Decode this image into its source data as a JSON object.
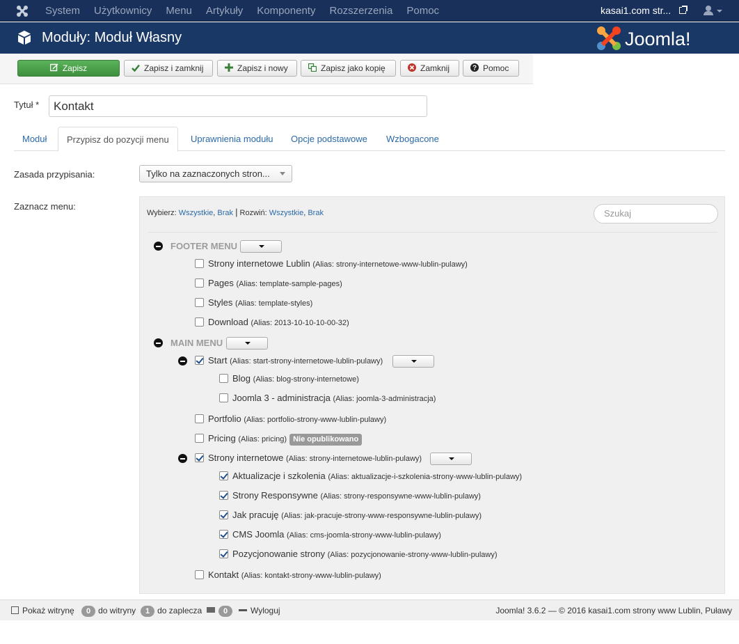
{
  "navbar": {
    "menu": [
      "System",
      "Użytkownicy",
      "Menu",
      "Artykuły",
      "Komponenty",
      "Rozszerzenia",
      "Pomoc"
    ],
    "site_name": "kasai1.com str...",
    "icons": [
      "joomla-icon",
      "external-link-icon",
      "user-icon"
    ]
  },
  "titlebar": {
    "title": "Moduły: Moduł Własny",
    "brand": "Joomla!"
  },
  "toolbar": {
    "save": "Zapisz",
    "save_close": "Zapisz i zamknij",
    "save_new": "Zapisz i nowy",
    "save_copy": "Zapisz jako kopię",
    "close": "Zamknij",
    "help": "Pomoc"
  },
  "form": {
    "title_label": "Tytuł *",
    "title_value": "Kontakt"
  },
  "tabs": [
    "Moduł",
    "Przypisz do pozycji menu",
    "Uprawnienia modułu",
    "Opcje podstawowe",
    "Wzbogacone"
  ],
  "assignment": {
    "label": "Zasada przypisania:",
    "value": "Tylko na zaznaczonych stron..."
  },
  "menu_select": {
    "label": "Zaznacz menu:",
    "select_label": "Wybierz:",
    "expand_label": "Rozwiń:",
    "all": "Wszystkie",
    "none": "Brak",
    "separator": ",",
    "pipe": "|",
    "search_placeholder": "Szukaj"
  },
  "tree": {
    "footer_menu": {
      "name": "FOOTER MENU",
      "items": [
        {
          "title": "Strony internetowe Lublin",
          "alias": "(Alias: strony-internetowe-www-lublin-pulawy)",
          "checked": false
        },
        {
          "title": "Pages",
          "alias": "(Alias: template-sample-pages)",
          "checked": false
        },
        {
          "title": "Styles",
          "alias": "(Alias: template-styles)",
          "checked": false
        },
        {
          "title": "Download",
          "alias": "(Alias: 2013-10-10-10-00-32)",
          "checked": false
        }
      ]
    },
    "main_menu": {
      "name": "MAIN MENU",
      "start": {
        "title": "Start",
        "alias": "(Alias: start-strony-internetowe-lublin-pulawy)",
        "checked": true
      },
      "start_children": [
        {
          "title": "Blog",
          "alias": "(Alias: blog-strony-internetowe)",
          "checked": false
        },
        {
          "title": "Joomla 3 - administracja",
          "alias": "(Alias: joomla-3-administracja)",
          "checked": false
        }
      ],
      "portfolio": {
        "title": "Portfolio",
        "alias": "(Alias: portfolio-strony-www-lublin-pulawy)",
        "checked": false
      },
      "pricing": {
        "title": "Pricing",
        "alias": "(Alias: pricing)",
        "checked": false,
        "badge": "Nie opublikowano"
      },
      "strony": {
        "title": "Strony internetowe",
        "alias": "(Alias: strony-internetowe-lublin-pulawy)",
        "checked": true
      },
      "strony_children": [
        {
          "title": "Aktualizacje i szkolenia",
          "alias": "(Alias: aktualizacje-i-szkolenia-strony-www-lublin-pulawy)",
          "checked": true
        },
        {
          "title": "Strony Responsywne",
          "alias": "(Alias: strony-responsywne-www-lublin-pulawy)",
          "checked": true
        },
        {
          "title": "Jak pracuję",
          "alias": "(Alias: jak-pracuje-strony-www-responsywne-lublin-pulawy)",
          "checked": true
        },
        {
          "title": "CMS Joomla",
          "alias": "(Alias: cms-joomla-strony-www-lublin-pulawy)",
          "checked": true
        },
        {
          "title": "Pozycjonowanie strony",
          "alias": "(Alias: pozycjonowanie-strony-www-lublin-pulawy)",
          "checked": true
        }
      ],
      "kontakt": {
        "title": "Kontakt",
        "alias": "(Alias: kontakt-strony-www-lublin-pulawy)",
        "checked": false
      }
    }
  },
  "footer": {
    "show_site": "Pokaż witrynę",
    "site_count": "0",
    "site_label": "do witryny",
    "admin_count": "1",
    "admin_label": "do zaplecza",
    "msg_count": "0",
    "logout": "Wyloguj",
    "copyright": "Joomla! 3.6.2  —  © 2016 kasai1.com strony www Lublin, Puławy"
  },
  "colors": {
    "navbar": "#18305a",
    "titlebar": "#1a3866",
    "save_button": "#4aa34a",
    "link": "#2a6aa8"
  }
}
